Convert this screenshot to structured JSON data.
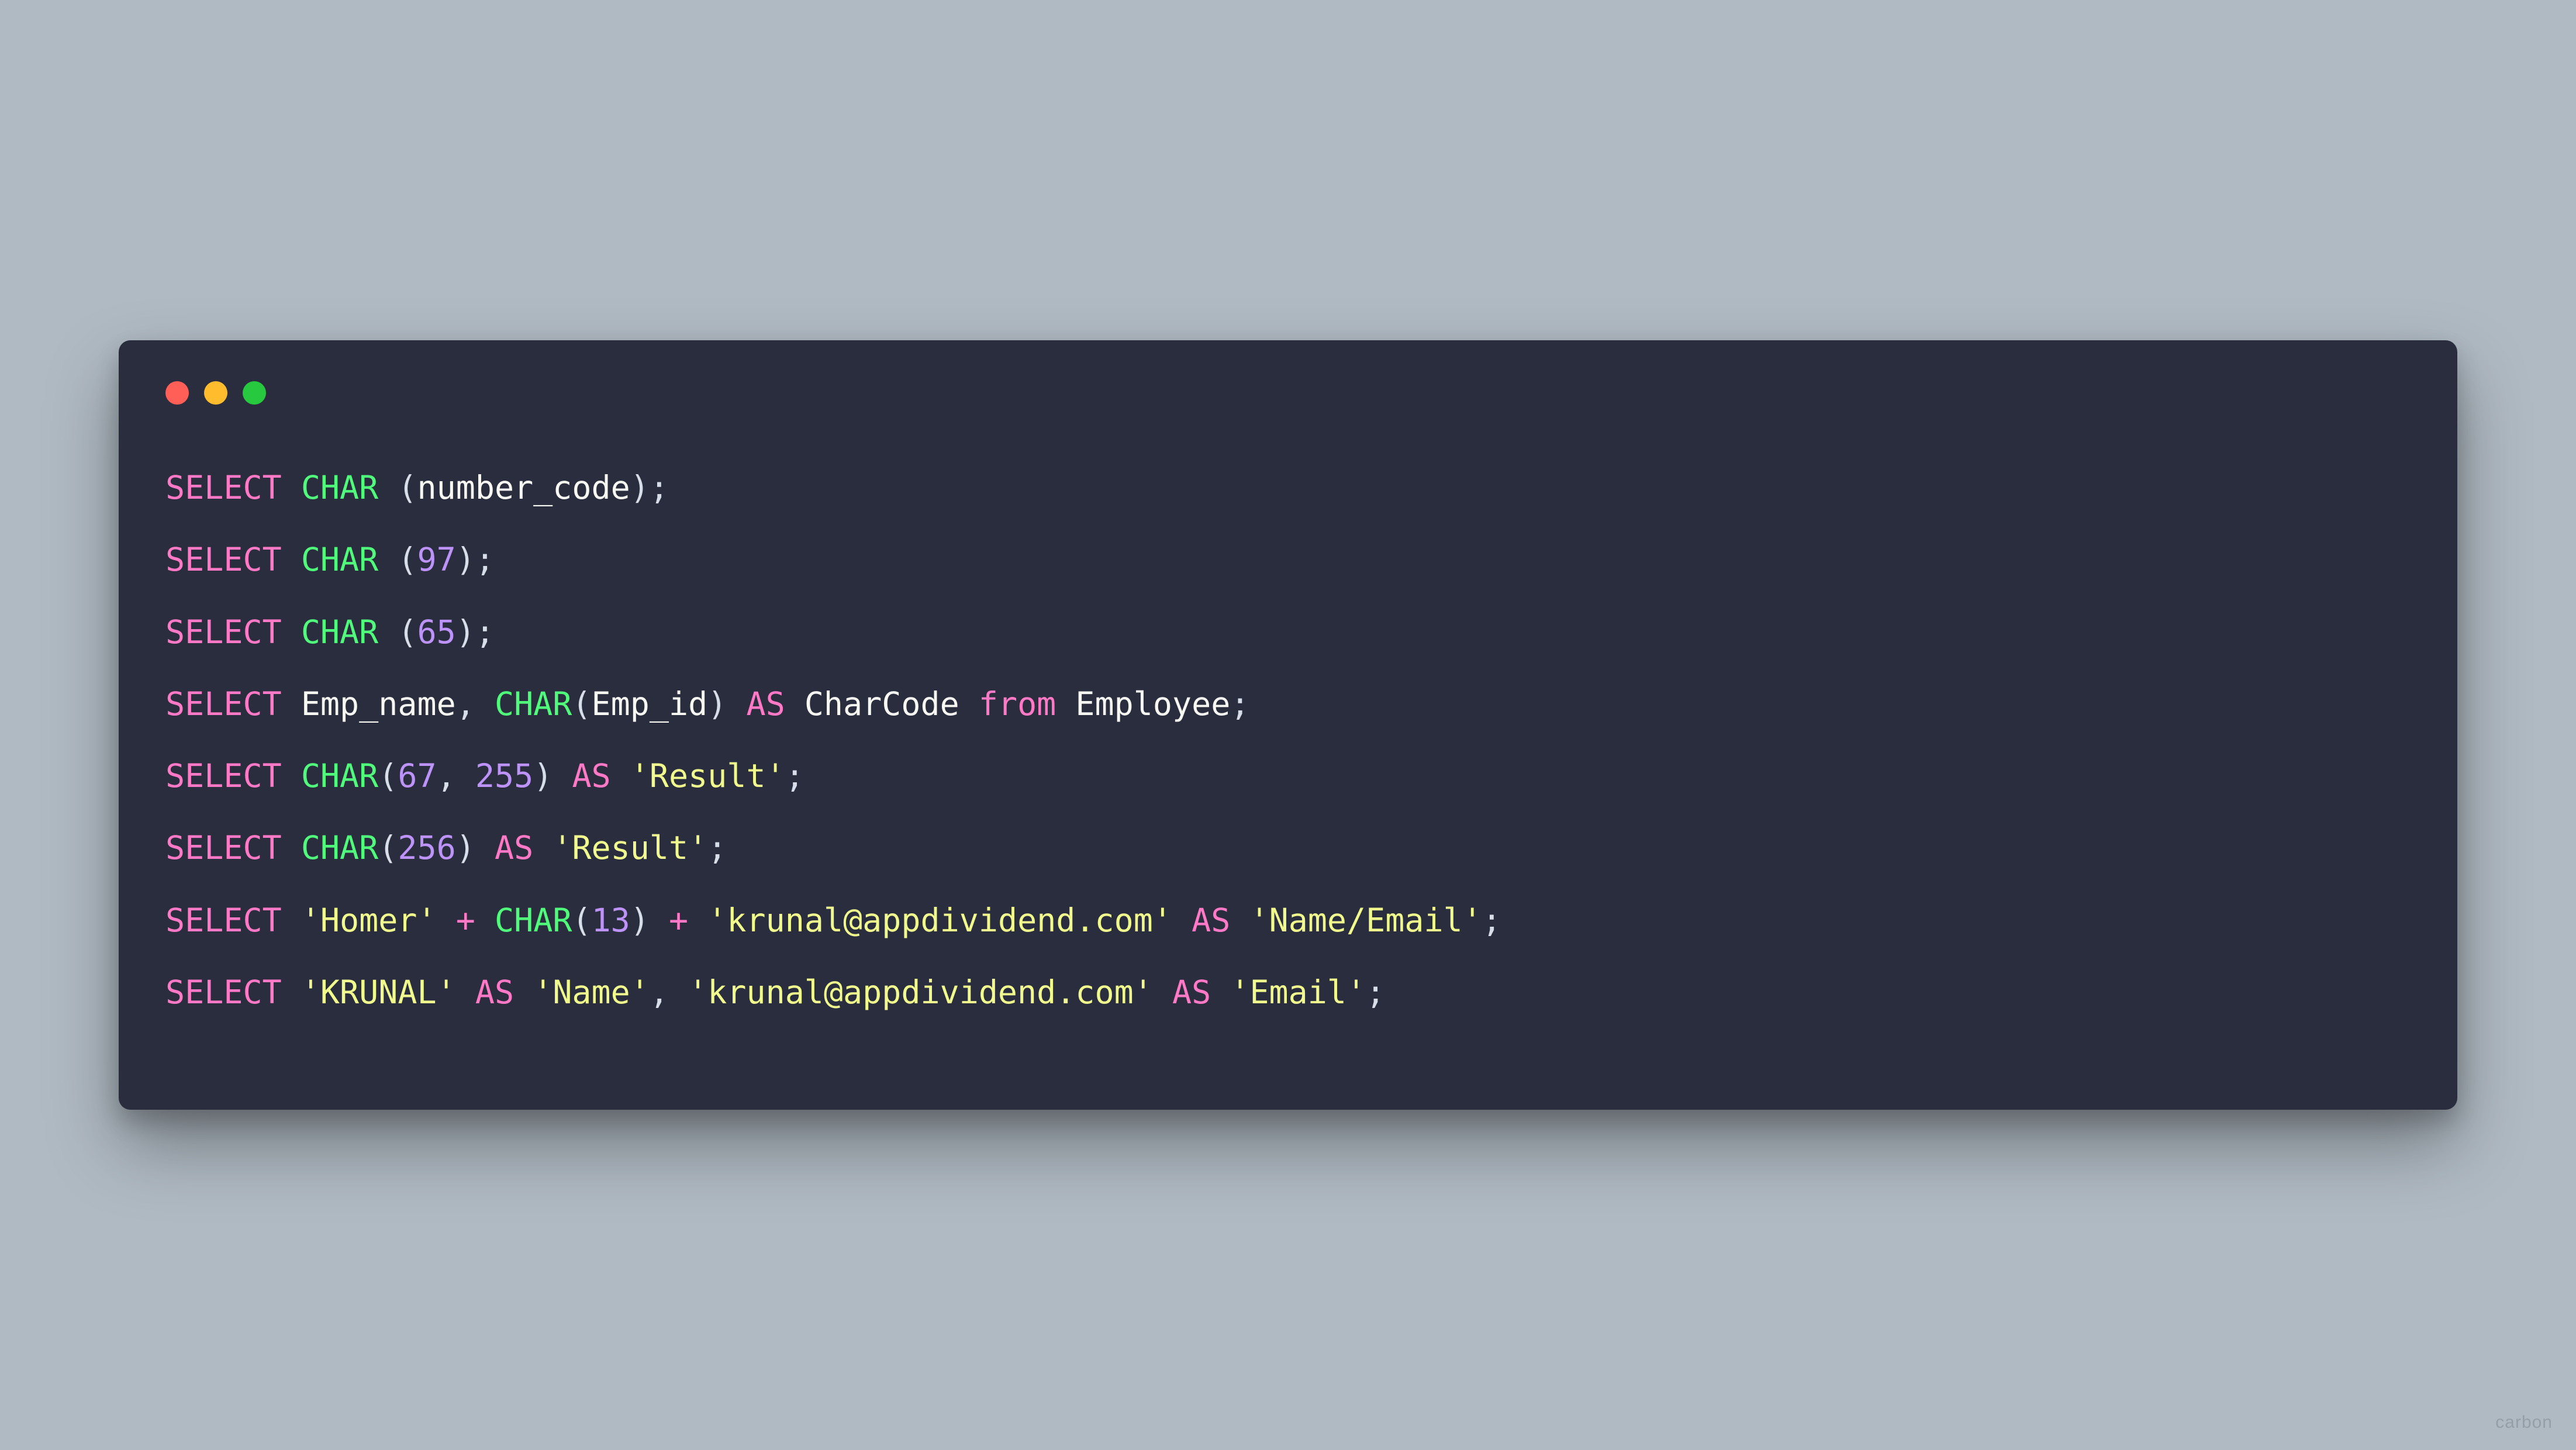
{
  "window": {
    "traffic_lights": {
      "close": "#ff5f56",
      "minimize": "#ffbd2e",
      "zoom": "#27c93f"
    }
  },
  "code": {
    "lines": [
      [
        {
          "t": "SELECT",
          "c": "kw"
        },
        {
          "t": " ",
          "c": "pn"
        },
        {
          "t": "CHAR",
          "c": "fn"
        },
        {
          "t": " (",
          "c": "pn"
        },
        {
          "t": "number_code",
          "c": "id"
        },
        {
          "t": ");",
          "c": "pn"
        }
      ],
      [
        {
          "t": "SELECT",
          "c": "kw"
        },
        {
          "t": " ",
          "c": "pn"
        },
        {
          "t": "CHAR",
          "c": "fn"
        },
        {
          "t": " (",
          "c": "pn"
        },
        {
          "t": "97",
          "c": "num"
        },
        {
          "t": ");",
          "c": "pn"
        }
      ],
      [
        {
          "t": "SELECT",
          "c": "kw"
        },
        {
          "t": " ",
          "c": "pn"
        },
        {
          "t": "CHAR",
          "c": "fn"
        },
        {
          "t": " (",
          "c": "pn"
        },
        {
          "t": "65",
          "c": "num"
        },
        {
          "t": ");",
          "c": "pn"
        }
      ],
      [
        {
          "t": "SELECT",
          "c": "kw"
        },
        {
          "t": " ",
          "c": "pn"
        },
        {
          "t": "Emp_name",
          "c": "id"
        },
        {
          "t": ", ",
          "c": "pn"
        },
        {
          "t": "CHAR",
          "c": "fn"
        },
        {
          "t": "(",
          "c": "pn"
        },
        {
          "t": "Emp_id",
          "c": "id"
        },
        {
          "t": ") ",
          "c": "pn"
        },
        {
          "t": "AS",
          "c": "kw"
        },
        {
          "t": " ",
          "c": "pn"
        },
        {
          "t": "CharCode",
          "c": "id"
        },
        {
          "t": " ",
          "c": "pn"
        },
        {
          "t": "from",
          "c": "kw"
        },
        {
          "t": " ",
          "c": "pn"
        },
        {
          "t": "Employee",
          "c": "id"
        },
        {
          "t": ";",
          "c": "pn"
        }
      ],
      [
        {
          "t": "SELECT",
          "c": "kw"
        },
        {
          "t": " ",
          "c": "pn"
        },
        {
          "t": "CHAR",
          "c": "fn"
        },
        {
          "t": "(",
          "c": "pn"
        },
        {
          "t": "67",
          "c": "num"
        },
        {
          "t": ", ",
          "c": "pn"
        },
        {
          "t": "255",
          "c": "num"
        },
        {
          "t": ") ",
          "c": "pn"
        },
        {
          "t": "AS",
          "c": "kw"
        },
        {
          "t": " ",
          "c": "pn"
        },
        {
          "t": "'Result'",
          "c": "str"
        },
        {
          "t": ";",
          "c": "pn"
        }
      ],
      [
        {
          "t": "SELECT",
          "c": "kw"
        },
        {
          "t": " ",
          "c": "pn"
        },
        {
          "t": "CHAR",
          "c": "fn"
        },
        {
          "t": "(",
          "c": "pn"
        },
        {
          "t": "256",
          "c": "num"
        },
        {
          "t": ") ",
          "c": "pn"
        },
        {
          "t": "AS",
          "c": "kw"
        },
        {
          "t": " ",
          "c": "pn"
        },
        {
          "t": "'Result'",
          "c": "str"
        },
        {
          "t": ";",
          "c": "pn"
        }
      ],
      [
        {
          "t": "SELECT",
          "c": "kw"
        },
        {
          "t": " ",
          "c": "pn"
        },
        {
          "t": "'Homer'",
          "c": "str"
        },
        {
          "t": " ",
          "c": "pn"
        },
        {
          "t": "+",
          "c": "op"
        },
        {
          "t": " ",
          "c": "pn"
        },
        {
          "t": "CHAR",
          "c": "fn"
        },
        {
          "t": "(",
          "c": "pn"
        },
        {
          "t": "13",
          "c": "num"
        },
        {
          "t": ") ",
          "c": "pn"
        },
        {
          "t": "+",
          "c": "op"
        },
        {
          "t": " ",
          "c": "pn"
        },
        {
          "t": "'krunal@appdividend.com'",
          "c": "str"
        },
        {
          "t": " ",
          "c": "pn"
        },
        {
          "t": "AS",
          "c": "kw"
        },
        {
          "t": " ",
          "c": "pn"
        },
        {
          "t": "'Name/Email'",
          "c": "str"
        },
        {
          "t": ";",
          "c": "pn"
        }
      ],
      [
        {
          "t": "SELECT",
          "c": "kw"
        },
        {
          "t": " ",
          "c": "pn"
        },
        {
          "t": "'KRUNAL'",
          "c": "str"
        },
        {
          "t": " ",
          "c": "pn"
        },
        {
          "t": "AS",
          "c": "kw"
        },
        {
          "t": " ",
          "c": "pn"
        },
        {
          "t": "'Name'",
          "c": "str"
        },
        {
          "t": ", ",
          "c": "pn"
        },
        {
          "t": "'krunal@appdividend.com'",
          "c": "str"
        },
        {
          "t": " ",
          "c": "pn"
        },
        {
          "t": "AS",
          "c": "kw"
        },
        {
          "t": " ",
          "c": "pn"
        },
        {
          "t": "'Email'",
          "c": "str"
        },
        {
          "t": ";",
          "c": "pn"
        }
      ]
    ]
  },
  "watermark": "carbon"
}
